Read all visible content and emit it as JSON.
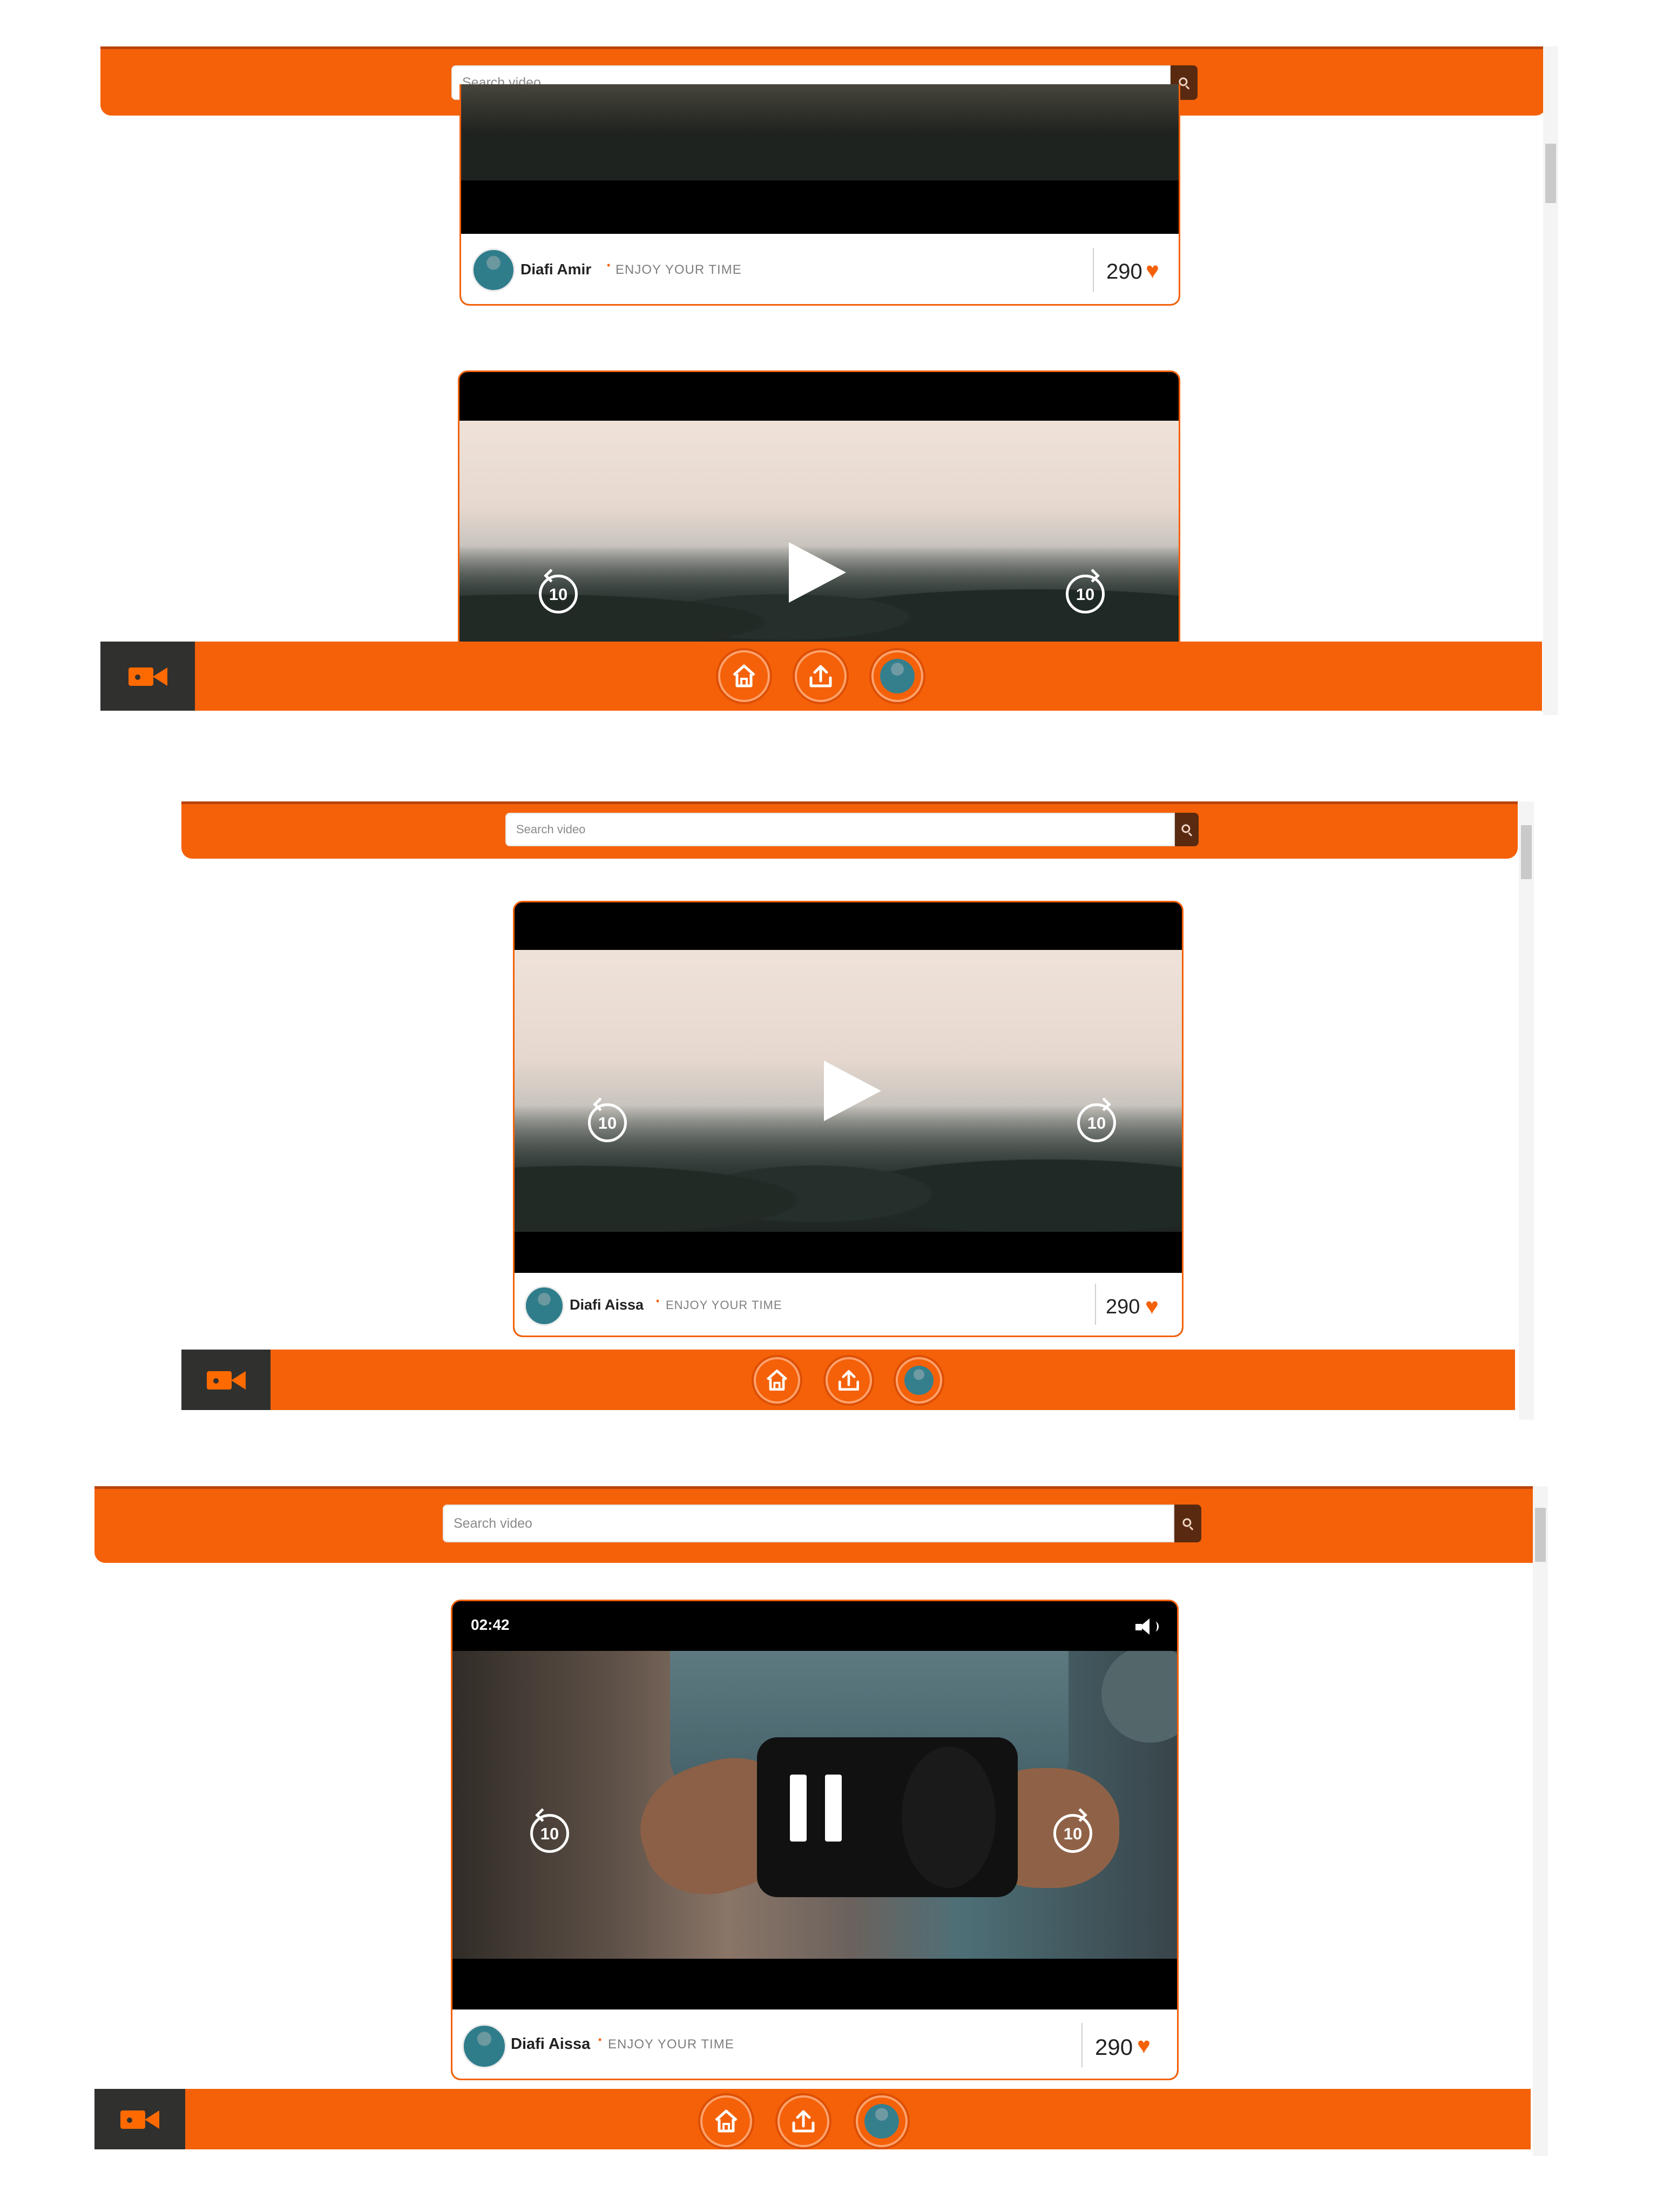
{
  "search": {
    "placeholder": "Search video"
  },
  "panels": [
    {
      "time": "",
      "card": {
        "author": "Diafi Amir",
        "subtitle": "ENJOY YOUR TIME",
        "likes": "290"
      },
      "card2": {
        "author": "",
        "subtitle": "",
        "likes": ""
      }
    },
    {
      "card": {
        "author": "Diafi Aissa",
        "subtitle": "ENJOY YOUR TIME",
        "likes": "290"
      }
    },
    {
      "time": "02:42",
      "card": {
        "author": "Diafi Aissa",
        "subtitle": "ENJOY YOUR TIME",
        "likes": "290"
      }
    }
  ],
  "skip": {
    "back": "10",
    "forward": "10"
  },
  "colors": {
    "brand": "#f46109",
    "dark": "#30302f",
    "search_button": "#5a2a10"
  },
  "icons": {
    "search": "magnifying-glass-icon",
    "logo": "video-camera-icon",
    "home": "home-icon",
    "upload": "upload-icon",
    "profile": "avatar-icon",
    "volume": "volume-icon",
    "play": "play-icon",
    "pause": "pause-icon"
  }
}
